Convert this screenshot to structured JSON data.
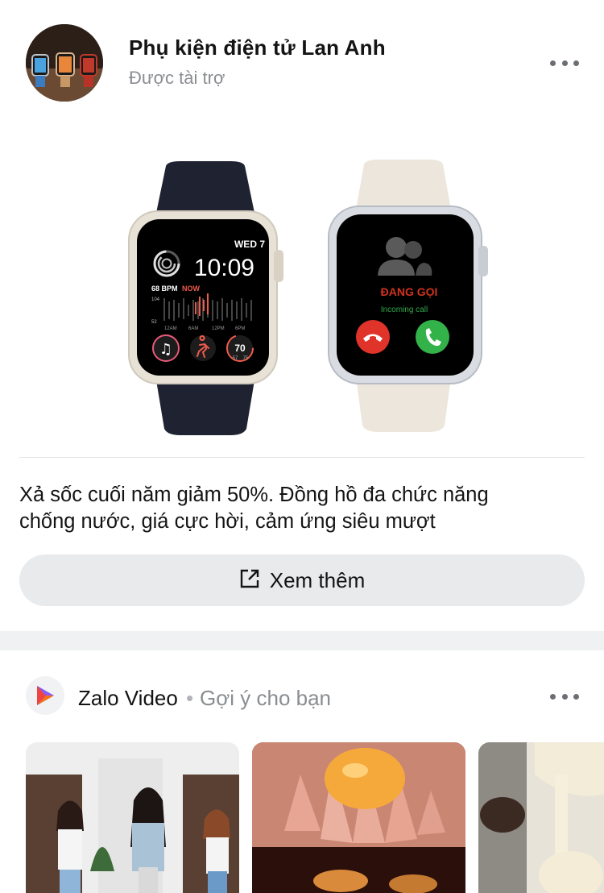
{
  "post": {
    "page_name": "Phụ kiện điện tử Lan Anh",
    "sponsored_label": "Được tài trợ",
    "caption_line1": "Xả sốc cuối năm giảm 50%. Đồng hồ đa chức năng",
    "caption_line2": "chống nước, giá cực hời, cảm ứng siêu mượt",
    "cta_label": "Xem thêm",
    "watch_left": {
      "date": "WED 7",
      "time": "10:09",
      "heart_rate": "68 BPM",
      "now": "NOW",
      "graph_high": "104",
      "graph_low": "52",
      "axis": [
        "12AM",
        "6AM",
        "12PM",
        "6PM"
      ],
      "complication_value": "70",
      "complication_range_low": "57",
      "complication_range_high": "75"
    },
    "watch_right": {
      "call_status": "ĐANG GỌI",
      "call_sub": "Incoming call"
    }
  },
  "video_section": {
    "title": "Zalo Video",
    "separator": "•",
    "subtitle": "Gợi ý cho bạn"
  },
  "colors": {
    "accent_gray": "#8a8d91",
    "cta_bg": "#e9eaec",
    "separator_bg": "#f0f1f3",
    "decline_red": "#e0332a",
    "accept_green": "#34b24a",
    "call_red": "#d0321f"
  },
  "icons": [
    "more-icon",
    "external-link-icon",
    "zalo-video-logo-icon"
  ]
}
